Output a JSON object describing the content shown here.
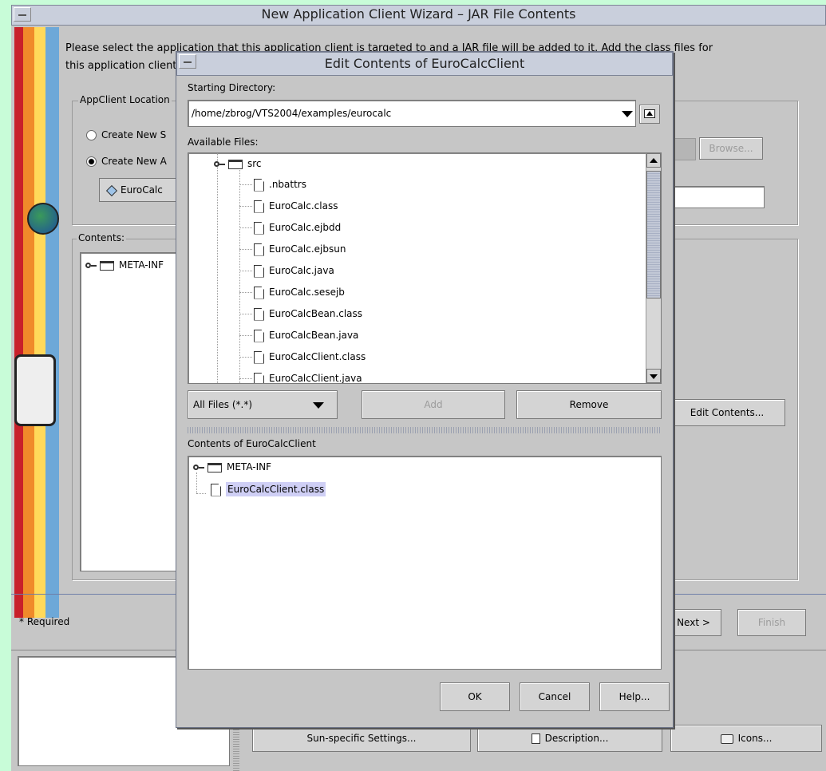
{
  "wizard": {
    "title": "New Application Client Wizard – JAR File Contents",
    "intro_line1": "Please select the application that this application client is targeted to and a JAR file will be added to it. Add the class files for",
    "intro_line2": "this application client",
    "location_group": "AppClient Location",
    "radio_new_standalone": "Create New S",
    "radio_new_in_app": "Create New A",
    "app_selected": "EuroCalc",
    "browse_label": "Browse...",
    "contents_group": "Contents:",
    "contents_tree_item": "META-INF",
    "edit_contents_label": "Edit Contents...",
    "required_label": "* Required",
    "next_label": "Next >",
    "finish_label": "Finish"
  },
  "bottom": {
    "sun_settings": "Sun-specific Settings...",
    "description": "Description...",
    "icons": "Icons..."
  },
  "dialog": {
    "title": "Edit Contents of EuroCalcClient",
    "starting_dir_label": "Starting Directory:",
    "starting_dir_value": "/home/zbrog/VTS2004/examples/eurocalc",
    "available_files_label": "Available Files:",
    "src_folder": "src",
    "files": [
      ".nbattrs",
      "EuroCalc.class",
      "EuroCalc.ejbdd",
      "EuroCalc.ejbsun",
      "EuroCalc.java",
      "EuroCalc.sesejb",
      "EuroCalcBean.class",
      "EuroCalcBean.java",
      "EuroCalcClient.class",
      "EuroCalcClient.java"
    ],
    "filter": "All Files (*.*)",
    "add_label": "Add",
    "remove_label": "Remove",
    "contents_label": "Contents of EuroCalcClient",
    "contents_folder": "META-INF",
    "contents_file": "EuroCalcClient.class",
    "ok_label": "OK",
    "cancel_label": "Cancel",
    "help_label": "Help..."
  }
}
